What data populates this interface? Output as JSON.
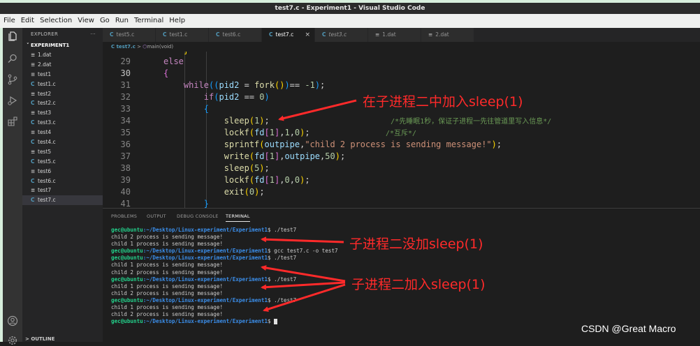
{
  "window": {
    "title": "test7.c - Experiment1 - Visual Studio Code"
  },
  "menu": [
    "File",
    "Edit",
    "Selection",
    "View",
    "Go",
    "Run",
    "Terminal",
    "Help"
  ],
  "activity_icons": [
    "files-icon",
    "search-icon",
    "source-control-icon",
    "run-debug-icon",
    "extensions-icon",
    "account-icon",
    "settings-gear-icon"
  ],
  "explorer": {
    "header": "EXPLORER",
    "more": "···",
    "project": "EXPERIMENT1",
    "files": [
      {
        "icon": "≡",
        "name": "1.dat"
      },
      {
        "icon": "≡",
        "name": "2.dat"
      },
      {
        "icon": "≡",
        "name": "test1"
      },
      {
        "icon": "C",
        "name": "test1.c"
      },
      {
        "icon": "≡",
        "name": "test2"
      },
      {
        "icon": "C",
        "name": "test2.c"
      },
      {
        "icon": "≡",
        "name": "test3"
      },
      {
        "icon": "C",
        "name": "test3.c"
      },
      {
        "icon": "≡",
        "name": "test4"
      },
      {
        "icon": "C",
        "name": "test4.c"
      },
      {
        "icon": "≡",
        "name": "test5"
      },
      {
        "icon": "C",
        "name": "test5.c"
      },
      {
        "icon": "≡",
        "name": "test6"
      },
      {
        "icon": "C",
        "name": "test6.c"
      },
      {
        "icon": "≡",
        "name": "test7"
      },
      {
        "icon": "C",
        "name": "test7.c"
      }
    ],
    "outline": "OUTLINE"
  },
  "tabs": [
    {
      "icon": "C",
      "label": "test5.c"
    },
    {
      "icon": "C",
      "label": "test1.c"
    },
    {
      "icon": "C",
      "label": "test6.c"
    },
    {
      "icon": "C",
      "label": "test7.c",
      "close": "×"
    },
    {
      "icon": "C",
      "label": "test3.c"
    },
    {
      "icon": "≡",
      "label": "1.dat"
    },
    {
      "icon": "≡",
      "label": "2.dat"
    }
  ],
  "breadcrumb": {
    "file": "C test7.c",
    "sep": ">",
    "symbol": "main(void)"
  },
  "code_lines": [
    "29",
    "30",
    "31",
    "32",
    "33",
    "34",
    "35",
    "36",
    "37",
    "38",
    "39",
    "40",
    "41"
  ],
  "panel": {
    "tabs": [
      "PROBLEMS",
      "OUTPUT",
      "DEBUG CONSOLE",
      "TERMINAL"
    ]
  },
  "terminal": {
    "prompt_user": "gec@ubuntu",
    "prompt_path": ":~/Desktop/Linux-experiment/Experiment1",
    "prompt_end": "$",
    "lines": [
      {
        "type": "prompt",
        "cmd": " ./test7"
      },
      {
        "type": "out",
        "text": "child 2 process is sending message!"
      },
      {
        "type": "out",
        "text": "child 1 process is sending message!"
      },
      {
        "type": "prompt",
        "cmd": " gcc test7.c -o test7"
      },
      {
        "type": "prompt",
        "cmd": " ./test7"
      },
      {
        "type": "out",
        "text": "child 1 process is sending message!"
      },
      {
        "type": "out",
        "text": "child 2 process is sending message!"
      },
      {
        "type": "prompt",
        "cmd": " ./test7"
      },
      {
        "type": "out",
        "text": "child 1 process is sending message!"
      },
      {
        "type": "out",
        "text": "child 2 process is sending message!"
      },
      {
        "type": "prompt",
        "cmd": " ./test7"
      },
      {
        "type": "out",
        "text": "child 1 process is sending message!"
      },
      {
        "type": "out",
        "text": "child 2 process is sending message!"
      },
      {
        "type": "prompt",
        "cmd": " ",
        "cursor": true
      }
    ]
  },
  "annotations": {
    "a1": "在子进程二中加入sleep(1)",
    "a2": "子进程二没加sleep(1)",
    "a3": "子进程二加入sleep(1)"
  },
  "watermark": "CSDN @Great Macro",
  "colors": {
    "annotation": "#ff2a2a",
    "accent": "#007acc"
  }
}
